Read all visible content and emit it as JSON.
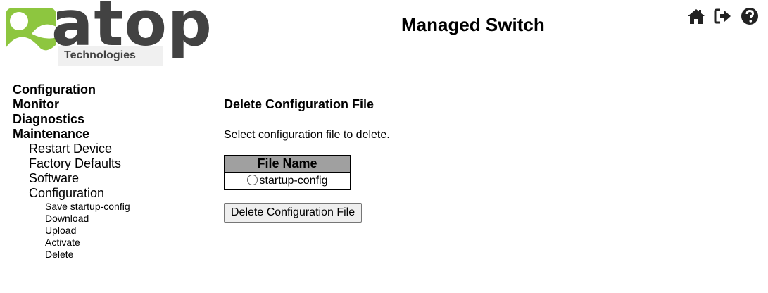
{
  "header": {
    "logo_text": "atop",
    "logo_subtext": "Technologies",
    "app_title": "Managed Switch",
    "icons": [
      "home-icon",
      "logout-icon",
      "help-icon"
    ]
  },
  "nav": {
    "items": [
      {
        "label": "Configuration",
        "level": 1
      },
      {
        "label": "Monitor",
        "level": 1
      },
      {
        "label": "Diagnostics",
        "level": 1
      },
      {
        "label": "Maintenance",
        "level": 1
      },
      {
        "label": "Restart Device",
        "level": 2
      },
      {
        "label": "Factory Defaults",
        "level": 2
      },
      {
        "label": "Software",
        "level": 2
      },
      {
        "label": "Configuration",
        "level": 2
      },
      {
        "label": "Save startup-config",
        "level": 3
      },
      {
        "label": "Download",
        "level": 3
      },
      {
        "label": "Upload",
        "level": 3
      },
      {
        "label": "Activate",
        "level": 3
      },
      {
        "label": "Delete",
        "level": 3
      }
    ]
  },
  "main": {
    "title": "Delete Configuration File",
    "description": "Select configuration file to delete.",
    "table": {
      "header": "File Name",
      "rows": [
        {
          "label": "startup-config",
          "selected": false
        }
      ]
    },
    "delete_button": "Delete Configuration File"
  },
  "colors": {
    "logo_green": "#8dc63f",
    "logo_gray": "#424242",
    "table_header_bg": "#a0a0a0"
  }
}
